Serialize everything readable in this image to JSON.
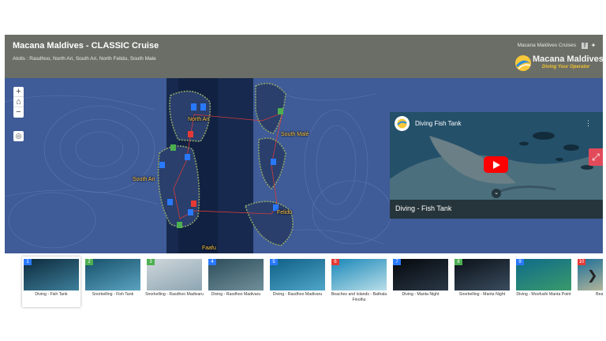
{
  "header": {
    "title": "Macana Maldives - CLASSIC Cruise",
    "subtitle": "Atolls : Rasdhoo, North Ari, South Ari, North Felidu, South Male",
    "cruises_label": "Macana Maldives Cruises",
    "logo_name": "Macana Maldives",
    "logo_tagline": "Diving Your Operator"
  },
  "map": {
    "labels": {
      "north_ari": "North Ari",
      "south_ari": "South Ari",
      "south_male": "South Malé",
      "felidu": "Felidu",
      "faafu": "Faafu"
    },
    "controls": {
      "zoom_in": "+",
      "home": "⌂",
      "zoom_out": "−",
      "locate": "◎"
    }
  },
  "video": {
    "channel_title": "Diving Fish Tank",
    "caption": "Diving - Fish Tank",
    "menu": "⋮"
  },
  "carousel": {
    "items": [
      {
        "num": "1",
        "label": "Diving - Fish Tank",
        "color": "#2979ff"
      },
      {
        "num": "2",
        "label": "Snorkelling - Fish Tank",
        "color": "#4caf50"
      },
      {
        "num": "3",
        "label": "Snorkelling - Rasdhoo Madivaru",
        "color": "#4caf50"
      },
      {
        "num": "4",
        "label": "Diving - Rasdhoo Madivaru",
        "color": "#2979ff"
      },
      {
        "num": "5",
        "label": "Diving - Rasdhoo Madivaru",
        "color": "#2979ff"
      },
      {
        "num": "6",
        "label": "Beaches and Islands - Bathala Finolhu",
        "color": "#e53935"
      },
      {
        "num": "7",
        "label": "Diving - Manta Night",
        "color": "#2979ff"
      },
      {
        "num": "8",
        "label": "Snorkelling - Manta Night",
        "color": "#4caf50"
      },
      {
        "num": "9",
        "label": "Diving - Moofushi Manta Point",
        "color": "#2979ff"
      },
      {
        "num": "10",
        "label": "Bea... Fi...",
        "color": "#e53935"
      }
    ],
    "next": "❯"
  }
}
